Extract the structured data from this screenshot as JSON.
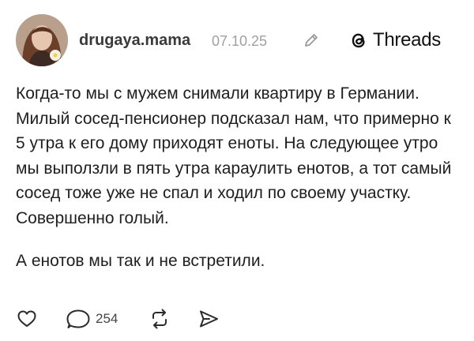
{
  "post": {
    "author": {
      "username": "drugaya.mama",
      "avatar": "avatar"
    },
    "date": "07.10.25",
    "edit_icon": "pencil-icon",
    "brand": {
      "logo_icon": "threads-logo-icon",
      "name": "Threads"
    },
    "paragraphs": [
      "Когда-то мы с мужем снимали квартиру в Германии. Милый сосед-пенсионер подсказал нам, что примерно к 5 утра к его дому приходят еноты. На следующее утро мы выползли в пять утра караулить енотов, а тот самый сосед тоже уже не спал и ходил по своему участку. Совершенно голый.",
      "А енотов мы так и не встретили."
    ],
    "actions": {
      "like_icon": "heart-icon",
      "comment_icon": "speech-bubble-icon",
      "comment_count": "254",
      "repost_icon": "repost-icon",
      "share_icon": "share-icon"
    }
  }
}
